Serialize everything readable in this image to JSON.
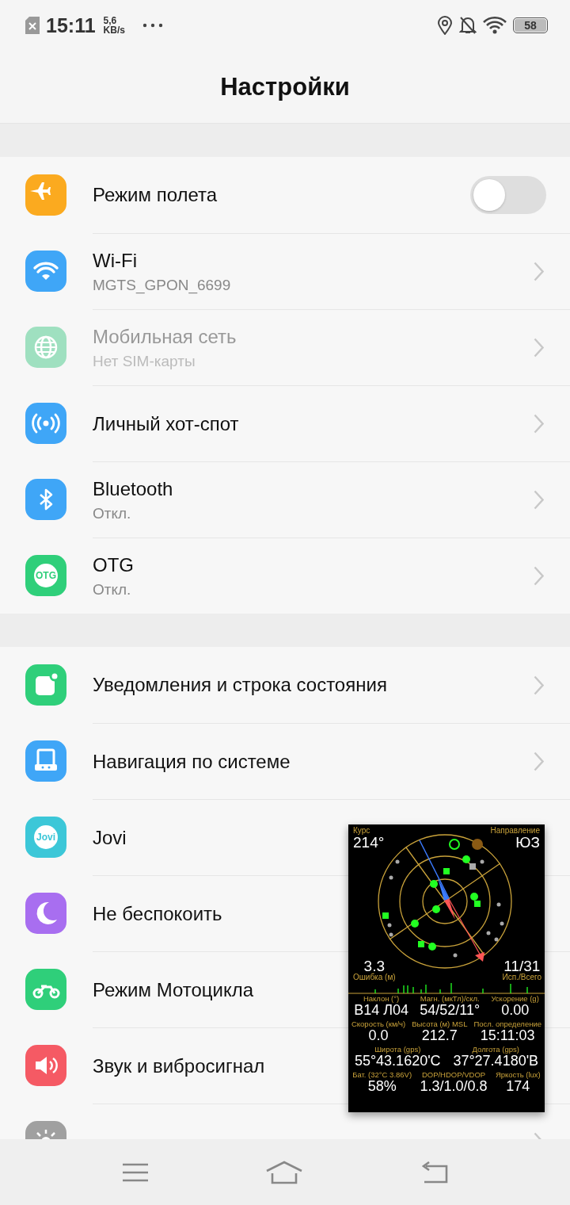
{
  "status_bar": {
    "time": "15:11",
    "speed": "5,6",
    "speed_unit": "KB/s",
    "battery": "58"
  },
  "header": {
    "title": "Настройки"
  },
  "groups": [
    {
      "items": [
        {
          "kind": "toggle",
          "title": "Режим полета",
          "on": false,
          "color": "#fbaa1f",
          "disabled": false
        },
        {
          "kind": "link",
          "title": "Wi-Fi",
          "subtitle": "MGTS_GPON_6699",
          "color": "#3fa6f7",
          "disabled": false
        },
        {
          "kind": "link",
          "title": "Мобильная сеть",
          "subtitle": "Нет SIM-карты",
          "color": "#9fe0c0",
          "disabled": true
        },
        {
          "kind": "link",
          "title": "Личный хот-спот",
          "color": "#3fa6f7",
          "disabled": false
        },
        {
          "kind": "link",
          "title": "Bluetooth",
          "subtitle": "Откл.",
          "color": "#3fa6f7",
          "disabled": false
        },
        {
          "kind": "link",
          "title": "OTG",
          "subtitle": "Откл.",
          "color": "#2fcf7a",
          "badge_text": "OTG",
          "disabled": false
        }
      ]
    },
    {
      "items": [
        {
          "kind": "link",
          "title": "Уведомления и строка состояния",
          "color": "#2fcf7a",
          "disabled": false
        },
        {
          "kind": "link",
          "title": "Навигация по системе",
          "color": "#3fa6f7",
          "disabled": false
        },
        {
          "kind": "link",
          "title": "Jovi",
          "color": "#3cc7d8",
          "badge_text": "Jovi",
          "disabled": false
        },
        {
          "kind": "link",
          "title": "Не беспокоить",
          "color": "#a86ef0",
          "disabled": false
        },
        {
          "kind": "link",
          "title": "Режим Мотоцикла",
          "color": "#2fcf7a",
          "disabled": false
        },
        {
          "kind": "link",
          "title": "Звук и вибросигнал",
          "color": "#f55a64",
          "disabled": false
        },
        {
          "kind": "link",
          "color": "#a0a0a0"
        }
      ]
    }
  ],
  "gps_overlay": {
    "course_label": "Курс",
    "course": "214°",
    "direction_label": "Направление",
    "direction": "ЮЗ",
    "error_value": "3.3",
    "error_label": "Ошибка (м)",
    "sats_value": "11/31",
    "sats_label": "Исп./Всего",
    "rows": [
      [
        {
          "label": "Наклон (°)",
          "value": "В14 Л04"
        },
        {
          "label": "Магн. (мкТл)/скл.",
          "value": "54/52/11°"
        },
        {
          "label": "Ускорение (g)",
          "value": "0.00"
        }
      ],
      [
        {
          "label": "Скорость (км/ч)",
          "value": "0.0"
        },
        {
          "label": "Высота (м) MSL",
          "value": "212.7"
        },
        {
          "label": "Посл. определение",
          "value": "15:11:03"
        }
      ],
      [
        {
          "label": "Широта (gps)",
          "value": "55°43.1620'С"
        },
        {
          "label": "Долгота (gps)",
          "value": "37°27.4180'В"
        }
      ],
      [
        {
          "label": "Бат. (32°C 3.86V)",
          "value": "58%"
        },
        {
          "label": "DOP/HDOP/VDOP",
          "value": "1.3/1.0/0.8"
        },
        {
          "label": "Яркость (lux)",
          "value": "174"
        }
      ]
    ]
  }
}
